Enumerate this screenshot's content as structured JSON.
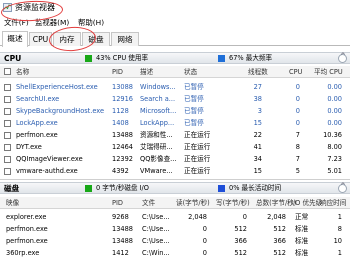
{
  "window": {
    "title": "资源监视器"
  },
  "menu": {
    "items": [
      "文件(F)",
      "监视器(M)",
      "帮助(H)"
    ]
  },
  "tabs": [
    "概述",
    "CPU",
    "内存",
    "磁盘",
    "网络"
  ],
  "colors": {
    "cpu_green": "#18a818",
    "cpu_blue": "#1f6fd8",
    "disk_green": "#18a818",
    "disk_blue": "#1f4fd8",
    "link": "#2a5db0",
    "annotation": "#e23c3c"
  },
  "cpu": {
    "title": "CPU",
    "usage_label": "43% CPU 使用率",
    "freq_label": "67% 最大频率",
    "columns": [
      "名称",
      "PID",
      "描述",
      "状态",
      "线程数",
      "CPU",
      "平均 CPU"
    ],
    "rows": [
      {
        "name": "ShellExperienceHost.exe",
        "pid": "13088",
        "desc": "Windows...",
        "status": "已暂停",
        "threads": "27",
        "cpu": "0",
        "avg": "0.00",
        "suspended": true
      },
      {
        "name": "SearchUI.exe",
        "pid": "12916",
        "desc": "Search a...",
        "status": "已暂停",
        "threads": "38",
        "cpu": "0",
        "avg": "0.00",
        "suspended": true
      },
      {
        "name": "SkypeBackgroundHost.exe",
        "pid": "1128",
        "desc": "Microsoft...",
        "status": "已暂停",
        "threads": "3",
        "cpu": "0",
        "avg": "0.00",
        "suspended": true
      },
      {
        "name": "LockApp.exe",
        "pid": "1408",
        "desc": "LockApp...",
        "status": "已暂停",
        "threads": "15",
        "cpu": "0",
        "avg": "0.00",
        "suspended": true
      },
      {
        "name": "perfmon.exe",
        "pid": "13488",
        "desc": "资源和性...",
        "status": "正在运行",
        "threads": "22",
        "cpu": "7",
        "avg": "10.36",
        "suspended": false
      },
      {
        "name": "DYT.exe",
        "pid": "12464",
        "desc": "艾瑞得研...",
        "status": "正在运行",
        "threads": "41",
        "cpu": "8",
        "avg": "8.00",
        "suspended": false
      },
      {
        "name": "QQImageViewer.exe",
        "pid": "12392",
        "desc": "QQ影像查...",
        "status": "正在运行",
        "threads": "34",
        "cpu": "7",
        "avg": "7.23",
        "suspended": false
      },
      {
        "name": "vmware-authd.exe",
        "pid": "4392",
        "desc": "VMware...",
        "status": "正在运行",
        "threads": "15",
        "cpu": "5",
        "avg": "5.01",
        "suspended": false
      }
    ]
  },
  "disk": {
    "title": "磁盘",
    "io_label": "0 字节/秒磁盘 I/O",
    "active_label": "0% 最长活动时间",
    "columns": [
      "映像",
      "PID",
      "文件",
      "读(字节/秒)",
      "写(字节/秒)",
      "总数(字节/秒)",
      "I/O 优先级",
      "响应时间"
    ],
    "rows": [
      {
        "image": "explorer.exe",
        "pid": "9268",
        "file": "C:\\Use...",
        "read": "2,048",
        "write": "0",
        "total": "2,048",
        "priority": "正常",
        "resp": "1"
      },
      {
        "image": "perfmon.exe",
        "pid": "13488",
        "file": "C:\\Use...",
        "read": "0",
        "write": "512",
        "total": "512",
        "priority": "标准",
        "resp": "8"
      },
      {
        "image": "perfmon.exe",
        "pid": "13488",
        "file": "C:\\Use...",
        "read": "0",
        "write": "366",
        "total": "366",
        "priority": "标准",
        "resp": "10"
      },
      {
        "image": "360rp.exe",
        "pid": "1412",
        "file": "C:\\Win...",
        "read": "0",
        "write": "512",
        "total": "512",
        "priority": "标准",
        "resp": "1"
      }
    ]
  }
}
